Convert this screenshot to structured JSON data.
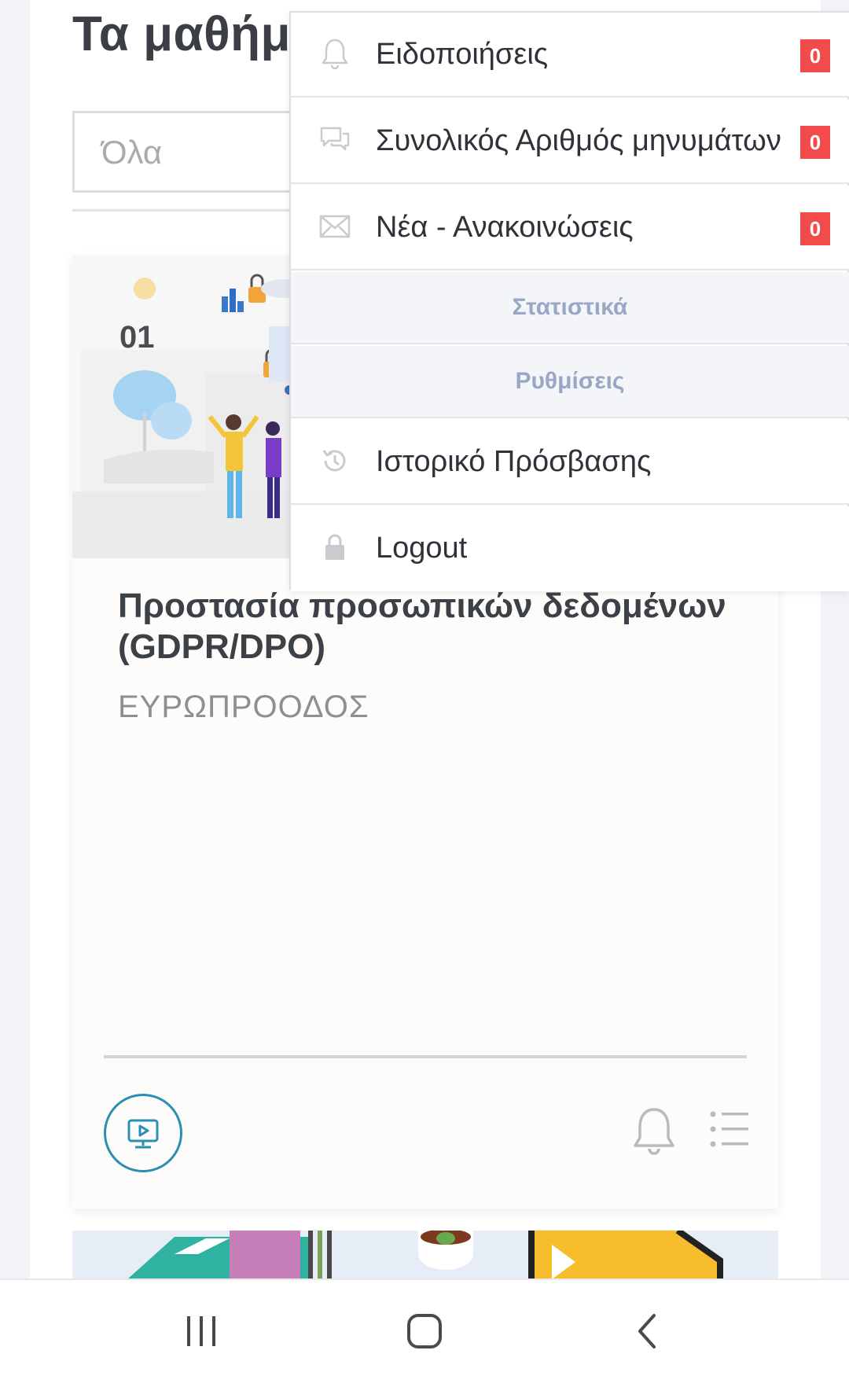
{
  "page": {
    "title": "Τα μαθήματα",
    "filter_value": "Όλα"
  },
  "course_card": {
    "number": "01",
    "title": "Προστασία προσωπικών δεδομένων (GDPR/DPO)",
    "provider": "ΕΥΡΩΠΡΟΟΔΟΣ",
    "icons": [
      "play-lesson-icon",
      "bell-icon",
      "list-icon"
    ]
  },
  "dropdown": {
    "items": [
      {
        "label": "Ειδοποιήσεις",
        "badge": "0",
        "icon": "bell-icon"
      },
      {
        "label": "Συνολικός Αριθμός μηνυμάτων",
        "badge": "0",
        "icon": "chat-bubbles-icon"
      },
      {
        "label": "Νέα - Ανακοινώσεις",
        "badge": "0",
        "icon": "envelope-icon"
      }
    ],
    "sections": [
      "Στατιστικά",
      "Ρυθμίσεις"
    ],
    "bottom_items": [
      {
        "label": "Ιστορικό Πρόσβασης",
        "icon": "history-icon"
      },
      {
        "label": "Logout",
        "icon": "lock-icon"
      }
    ]
  },
  "nav_bar": {
    "icons": [
      "recent-apps-icon",
      "home-icon",
      "back-icon"
    ]
  },
  "colors": {
    "badge": "#f24b4b",
    "section_text": "#9aa6c6",
    "accent": "#2a8fb2"
  }
}
